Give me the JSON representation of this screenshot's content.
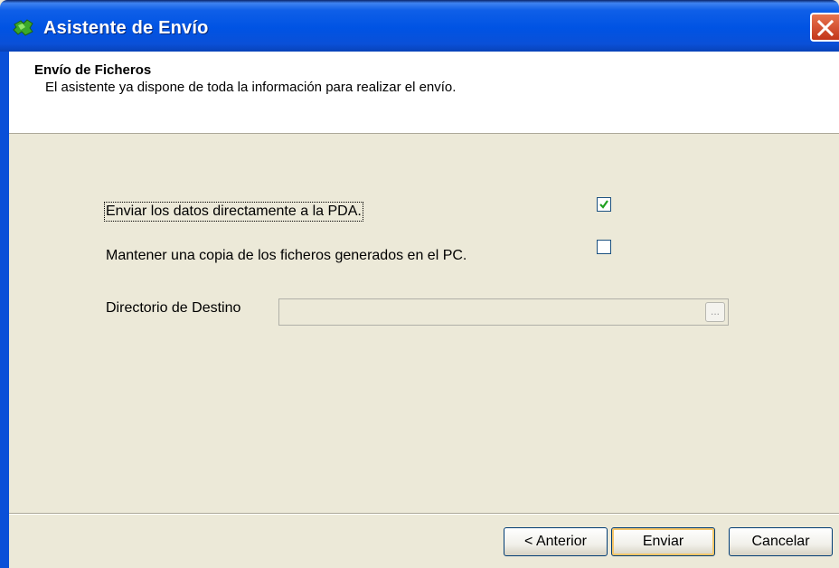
{
  "window": {
    "title": "Asistente de Envío"
  },
  "header": {
    "title": "Envío de Ficheros",
    "subtitle": "El asistente ya dispone de toda la información para realizar el envío."
  },
  "options": {
    "send_pda_label": "Enviar los datos directamente a la PDA.",
    "send_pda_checked": true,
    "keep_copy_label": "Mantener una copia de los ficheros generados en el PC.",
    "keep_copy_checked": false
  },
  "destination": {
    "label": "Directorio de Destino",
    "value": "",
    "browse_label": "..."
  },
  "buttons": {
    "back": "< Anterior",
    "send": "Enviar",
    "cancel": "Cancelar"
  },
  "colors": {
    "titlebar": "#0053e3",
    "close": "#c2351a",
    "default_button_ring": "#f6c66a",
    "checkmark": "#21a121"
  },
  "icons": {
    "app": "green-puzzle-icon",
    "close": "close-icon",
    "check": "checkmark-icon"
  }
}
